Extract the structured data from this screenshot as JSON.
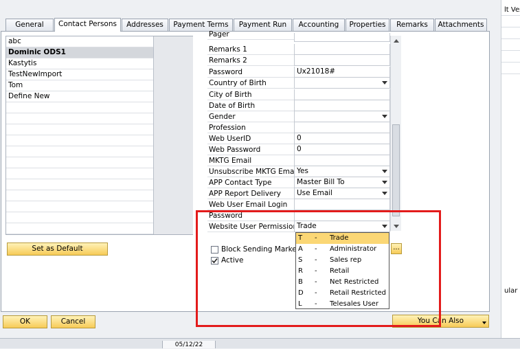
{
  "tabs": [
    "General",
    "Contact Persons",
    "Addresses",
    "Payment Terms",
    "Payment Run",
    "Accounting",
    "Properties",
    "Remarks",
    "Attachments"
  ],
  "contacts": [
    "abc",
    "Dominic ODS1",
    "Kastytis",
    "TestNewImport",
    "Tom",
    "Define New"
  ],
  "buttons": {
    "set_default": "Set as Default",
    "ok": "OK",
    "cancel": "Cancel",
    "you_can_also": "You Can Also",
    "ellipsis": "..."
  },
  "fields": [
    {
      "label": "Pager",
      "value": ""
    },
    {
      "label": "Remarks 1",
      "value": ""
    },
    {
      "label": "Remarks 2",
      "value": ""
    },
    {
      "label": "Password",
      "value": "Ux21018#"
    },
    {
      "label": "Country of Birth",
      "value": ""
    },
    {
      "label": "City of Birth",
      "value": ""
    },
    {
      "label": "Date of Birth",
      "value": ""
    },
    {
      "label": "Gender",
      "value": ""
    },
    {
      "label": "Profession",
      "value": ""
    },
    {
      "label": "Web UserID",
      "value": "0"
    },
    {
      "label": "Web Password",
      "value": "0"
    },
    {
      "label": "MKTG Email",
      "value": ""
    },
    {
      "label": "Unsubscribe MKTG Email",
      "value": "Yes"
    },
    {
      "label": "APP Contact Type",
      "value": "Master Bill To"
    },
    {
      "label": "APP Report Delivery",
      "value": "Use Email"
    },
    {
      "label": "Web User Email Login",
      "value": ""
    },
    {
      "label": "Password",
      "value": ""
    },
    {
      "label": "Website User Permissions",
      "value": "Trade"
    }
  ],
  "checkboxes": {
    "block_sending": "Block Sending Marketin",
    "active": "Active"
  },
  "permission_options": [
    {
      "code": "T",
      "dash": "-",
      "name": "Trade"
    },
    {
      "code": "A",
      "dash": "-",
      "name": "Administrator"
    },
    {
      "code": "S",
      "dash": "-",
      "name": "Sales rep"
    },
    {
      "code": "R",
      "dash": "-",
      "name": "Retail"
    },
    {
      "code": "B",
      "dash": "-",
      "name": "Net Restricted"
    },
    {
      "code": "D",
      "dash": "-",
      "name": "Retail Restricted"
    },
    {
      "code": "L",
      "dash": "-",
      "name": "Telesales User"
    }
  ],
  "right_strip": {
    "top_text": "lt Vest",
    "mid_text": "ular"
  },
  "status": {
    "date": "05/12/22"
  },
  "colors": {
    "highlight_border": "#e31b1b",
    "button_yellow": "#f7cb57",
    "selected_option": "#fbd775"
  }
}
